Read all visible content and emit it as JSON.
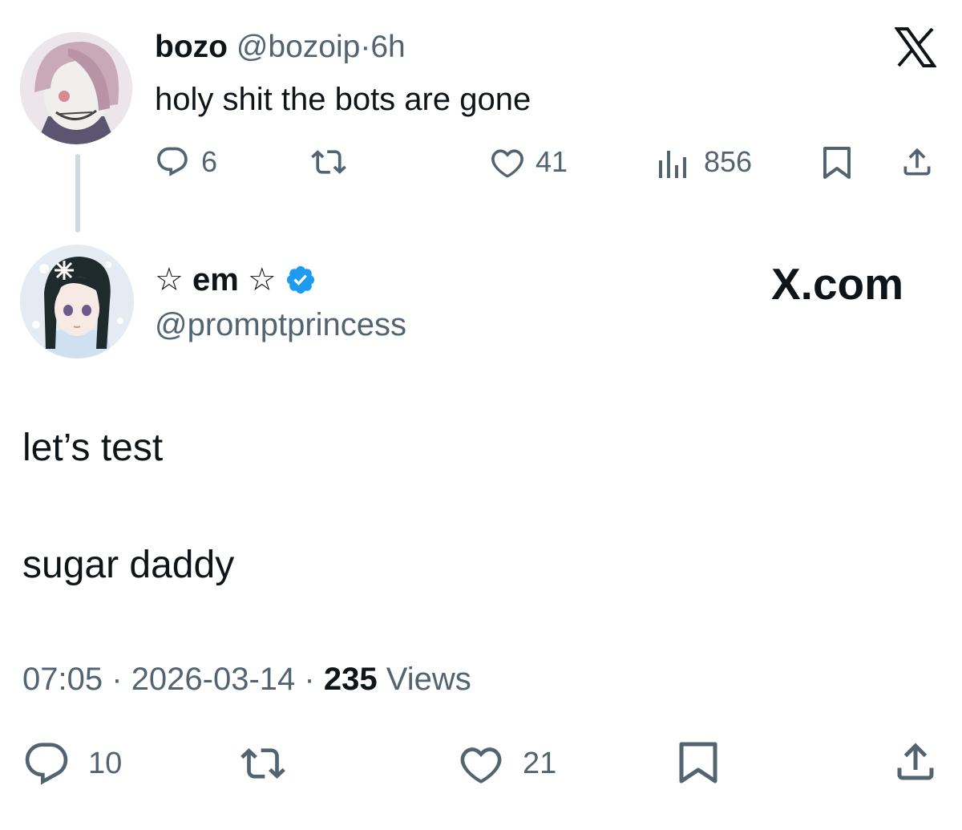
{
  "reply_to": {
    "display_name": "bozo",
    "handle": "@bozoip",
    "separator": "·",
    "time": "6h",
    "text": "holy shit the bots are gone",
    "stats": {
      "replies": "6",
      "likes": "41",
      "views": "856"
    }
  },
  "main": {
    "display_name": "☆ em ☆",
    "handle": "@promptprincess",
    "site_label": "X.com",
    "paragraphs": [
      "let’s test",
      "sugar daddy"
    ],
    "meta": {
      "time": "07:05",
      "sep1": "·",
      "date": "2026-03-14",
      "sep2": "·",
      "views_count": "235",
      "views_label": "Views"
    },
    "stats": {
      "replies": "10",
      "likes": "21"
    }
  },
  "icons": [
    "x-logo-icon",
    "reply-icon",
    "repost-icon",
    "like-icon",
    "views-icon",
    "bookmark-icon",
    "share-icon",
    "verified-badge-icon"
  ],
  "colors": {
    "verified": "#1d9bf0",
    "secondary_text": "#536471",
    "text": "#0f1419"
  }
}
